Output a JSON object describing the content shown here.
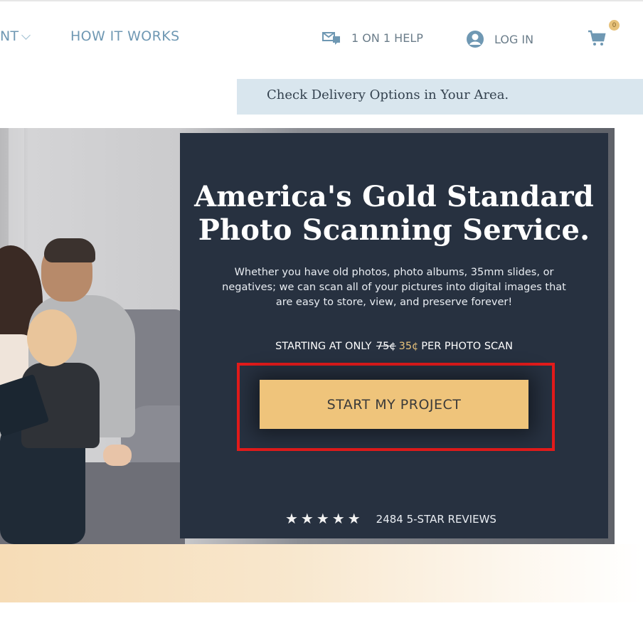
{
  "nav": {
    "left_partial": "NT",
    "how_it_works": "HOW IT WORKS",
    "help": "1 ON 1 HELP",
    "login": "LOG IN",
    "cart_count": "0"
  },
  "delivery": {
    "text": "Check Delivery Options in Your Area."
  },
  "hero": {
    "title_line1": "America's Gold Standard",
    "title_line2": "Photo Scanning Service.",
    "description": "Whether you have old photos, photo albums, 35mm slides, or negatives; we can scan all of your pictures into digital images that are easy to store, view, and preserve forever!",
    "price_prefix": "STARTING AT ONLY",
    "price_old": "75¢",
    "price_new": "35¢",
    "price_suffix": "PER PHOTO SCAN",
    "cta_label": "START MY PROJECT",
    "stars": "★★★★★",
    "reviews_label": "2484 5-STAR REVIEWS"
  },
  "colors": {
    "accent_gold": "#efc47b",
    "card_navy": "#273140",
    "nav_blue": "#6f98b3",
    "highlight_red": "#e31b1b"
  },
  "icons": [
    "chevron-down-icon",
    "chat-envelope-icon",
    "user-icon",
    "cart-icon",
    "star-icon"
  ]
}
